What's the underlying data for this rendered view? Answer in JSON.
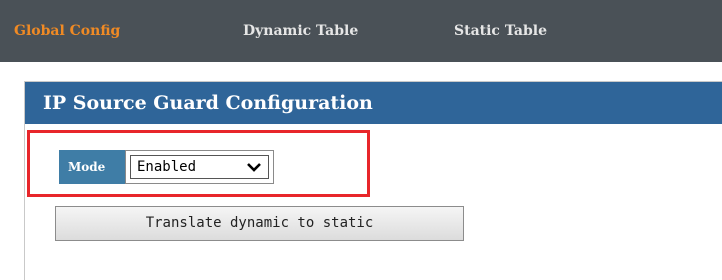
{
  "tabs": [
    {
      "label": "Global Config",
      "active": true
    },
    {
      "label": "Dynamic Table",
      "active": false
    },
    {
      "label": "Static Table",
      "active": false
    }
  ],
  "panel": {
    "title": "IP Source Guard Configuration"
  },
  "mode": {
    "label": "Mode",
    "selected": "Enabled",
    "chevron_icon": "chevron-down-icon"
  },
  "translate_button": {
    "label": "Translate dynamic to static"
  },
  "colors": {
    "tabbar_bg": "#4a5157",
    "active_tab": "#f08a24",
    "header_bg": "#2f6599",
    "mode_label_bg": "#3f7da6",
    "highlight": "#e8262a"
  }
}
